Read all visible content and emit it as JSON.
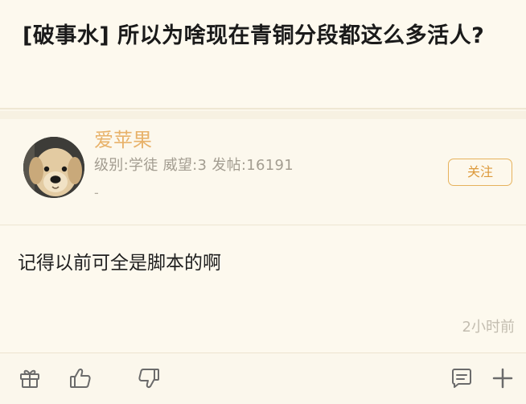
{
  "post": {
    "title": "[破事水] 所以为啥现在青铜分段都这么多活人?",
    "body": "记得以前可全是脚本的啊",
    "time": "2小时前"
  },
  "author": {
    "name": "爱苹果",
    "meta": "级别:学徒 威望:3 发帖:16191",
    "signature": "-"
  },
  "actions": {
    "follow_label": "关注"
  },
  "colors": {
    "accent": "#e8b26a",
    "background": "#fbf7ec",
    "icon": "#6b6b6b"
  },
  "icons": [
    "gift-icon",
    "thumbs-up-icon",
    "thumbs-down-icon",
    "comment-icon",
    "plus-icon"
  ]
}
